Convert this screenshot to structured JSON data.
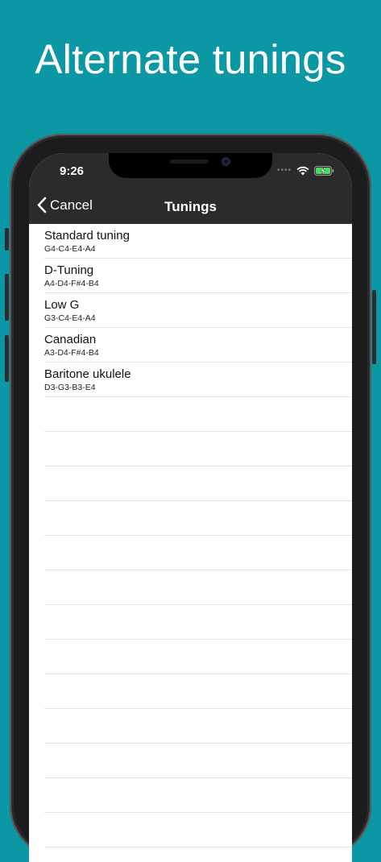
{
  "headline": "Alternate tunings",
  "status_bar": {
    "time": "9:26"
  },
  "navbar": {
    "back_label": "Cancel",
    "title": "Tunings"
  },
  "tunings": [
    {
      "name": "Standard tuning",
      "notes": "G4-C4-E4-A4"
    },
    {
      "name": "D-Tuning",
      "notes": "A4-D4-F#4-B4"
    },
    {
      "name": "Low G",
      "notes": "G3-C4-E4-A4"
    },
    {
      "name": "Canadian",
      "notes": "A3-D4-F#4-B4"
    },
    {
      "name": "Baritone ukulele",
      "notes": "D3-G3-B3-E4"
    }
  ],
  "colors": {
    "background": "#0b97a3",
    "bar": "#2b2b2b",
    "battery": "#4cd964"
  }
}
